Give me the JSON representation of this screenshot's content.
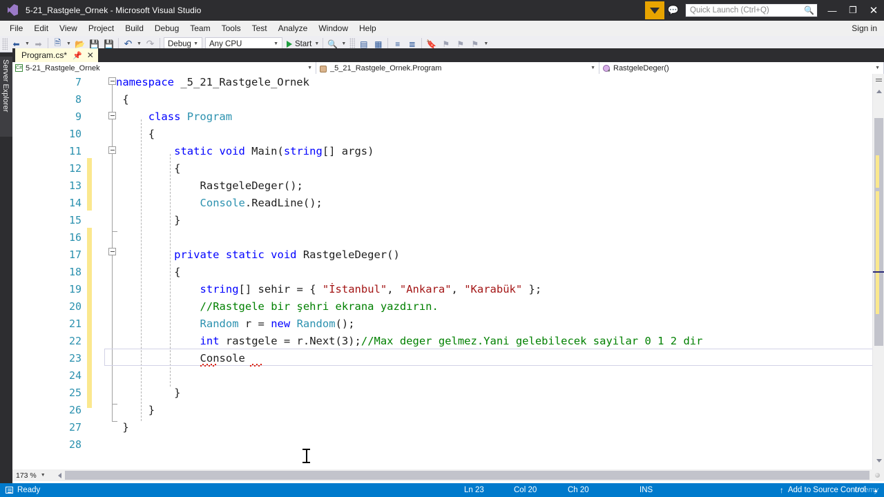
{
  "titlebar": {
    "logo": "vs-logo",
    "title": "5-21_Rastgele_Ornek - Microsoft Visual Studio",
    "filter_icon": "funnel-icon",
    "feedback_icon": "feedback-icon",
    "quick_launch_placeholder": "Quick Launch (Ctrl+Q)",
    "quick_launch_value": "",
    "search_icon": "magnifier-icon",
    "minimize": "—",
    "restore": "❐",
    "close": "✕"
  },
  "menubar": {
    "items": [
      {
        "label": "File"
      },
      {
        "label": "Edit"
      },
      {
        "label": "View"
      },
      {
        "label": "Project"
      },
      {
        "label": "Build"
      },
      {
        "label": "Debug"
      },
      {
        "label": "Team"
      },
      {
        "label": "Tools"
      },
      {
        "label": "Test"
      },
      {
        "label": "Analyze"
      },
      {
        "label": "Window"
      },
      {
        "label": "Help"
      }
    ],
    "signin": "Sign in"
  },
  "toolbar": {
    "navigate_back_icon": "navigate-back-icon",
    "navigate_forward_icon": "navigate-forward-icon",
    "new_project_icon": "new-project-icon",
    "open_file_icon": "open-file-icon",
    "save_icon": "save-icon",
    "save_all_icon": "save-all-icon",
    "undo_icon": "undo-icon",
    "redo_icon": "redo-icon",
    "config_value": "Debug",
    "platform_value": "Any CPU",
    "start_label": "Start",
    "find_icon": "find-icon",
    "comment_icon": "comment-icon",
    "uncomment_icon": "uncomment-icon",
    "indent_icon": "indent-icon",
    "outdent_icon": "outdent-icon",
    "bookmark_icon": "bookmark-icon",
    "bookmark_prev_icon": "bookmark-prev-icon",
    "bookmark_next_icon": "bookmark-next-icon",
    "bookmark_clear_icon": "bookmark-clear-icon",
    "overflow_icon": "toolbar-overflow-icon"
  },
  "leftdock": {
    "server_explorer": "Server Explorer"
  },
  "tabs": {
    "active": {
      "label": "Program.cs*",
      "pin_icon": "pin-icon",
      "close_icon": "close-icon"
    }
  },
  "navbar": {
    "project": "5-21_Rastgele_Ornek",
    "project_icon": "csharp-file-icon",
    "type": "_5_21_Rastgele_Ornek.Program",
    "type_icon": "class-icon",
    "member": "RastgeleDeger()",
    "member_icon": "method-icon",
    "dropdown_icon": "chevron-down-icon"
  },
  "editor": {
    "language": "csharp",
    "first_visible_line": 7,
    "caret_line": 23,
    "lines": [
      {
        "num": 7,
        "tokens": [
          {
            "t": "namespace",
            "c": "kw"
          },
          {
            "t": " _5_21_Rastgele_Ornek",
            "c": "pl"
          }
        ],
        "indent": 0
      },
      {
        "num": 8,
        "tokens": [
          {
            "t": "{",
            "c": "pl"
          }
        ],
        "indent": 1
      },
      {
        "num": 9,
        "tokens": [
          {
            "t": "class",
            "c": "kw"
          },
          {
            "t": " ",
            "c": "pl"
          },
          {
            "t": "Program",
            "c": "ty"
          }
        ],
        "indent": 5
      },
      {
        "num": 10,
        "tokens": [
          {
            "t": "{",
            "c": "pl"
          }
        ],
        "indent": 5
      },
      {
        "num": 11,
        "tokens": [
          {
            "t": "static",
            "c": "kw"
          },
          {
            "t": " ",
            "c": "pl"
          },
          {
            "t": "void",
            "c": "kw"
          },
          {
            "t": " Main(",
            "c": "pl"
          },
          {
            "t": "string",
            "c": "kw"
          },
          {
            "t": "[] args)",
            "c": "pl"
          }
        ],
        "indent": 9
      },
      {
        "num": 12,
        "tokens": [
          {
            "t": "{",
            "c": "pl"
          }
        ],
        "indent": 9
      },
      {
        "num": 13,
        "tokens": [
          {
            "t": "RastgeleDeger();",
            "c": "pl"
          }
        ],
        "indent": 13
      },
      {
        "num": 14,
        "tokens": [
          {
            "t": "Console",
            "c": "ty"
          },
          {
            "t": ".ReadLine();",
            "c": "pl"
          }
        ],
        "indent": 13
      },
      {
        "num": 15,
        "tokens": [
          {
            "t": "}",
            "c": "pl"
          }
        ],
        "indent": 9
      },
      {
        "num": 16,
        "tokens": [],
        "indent": 0
      },
      {
        "num": 17,
        "tokens": [
          {
            "t": "private",
            "c": "kw"
          },
          {
            "t": " ",
            "c": "pl"
          },
          {
            "t": "static",
            "c": "kw"
          },
          {
            "t": " ",
            "c": "pl"
          },
          {
            "t": "void",
            "c": "kw"
          },
          {
            "t": " RastgeleDeger()",
            "c": "pl"
          }
        ],
        "indent": 9
      },
      {
        "num": 18,
        "tokens": [
          {
            "t": "{",
            "c": "pl"
          }
        ],
        "indent": 9
      },
      {
        "num": 19,
        "tokens": [
          {
            "t": "string",
            "c": "kw"
          },
          {
            "t": "[] sehir = { ",
            "c": "pl"
          },
          {
            "t": "\"İstanbul\"",
            "c": "st"
          },
          {
            "t": ", ",
            "c": "pl"
          },
          {
            "t": "\"Ankara\"",
            "c": "st"
          },
          {
            "t": ", ",
            "c": "pl"
          },
          {
            "t": "\"Karabük\"",
            "c": "st"
          },
          {
            "t": " };",
            "c": "pl"
          }
        ],
        "indent": 13
      },
      {
        "num": 20,
        "tokens": [
          {
            "t": "//Rastgele bir şehri ekrana yazdırın.",
            "c": "cm"
          }
        ],
        "indent": 13
      },
      {
        "num": 21,
        "tokens": [
          {
            "t": "Random",
            "c": "ty"
          },
          {
            "t": " r = ",
            "c": "pl"
          },
          {
            "t": "new",
            "c": "kw"
          },
          {
            "t": " ",
            "c": "pl"
          },
          {
            "t": "Random",
            "c": "ty"
          },
          {
            "t": "();",
            "c": "pl"
          }
        ],
        "indent": 13
      },
      {
        "num": 22,
        "tokens": [
          {
            "t": "int",
            "c": "kw"
          },
          {
            "t": " rastgele = r.Next(3);",
            "c": "pl"
          },
          {
            "t": "//Max deger gelmez.Yani gelebilecek sayilar 0 1 2 dir",
            "c": "cm"
          }
        ],
        "indent": 13
      },
      {
        "num": 23,
        "tokens": [
          {
            "t": "Console",
            "c": "pl"
          }
        ],
        "indent": 13
      },
      {
        "num": 24,
        "tokens": [],
        "indent": 0
      },
      {
        "num": 25,
        "tokens": [
          {
            "t": "}",
            "c": "pl"
          }
        ],
        "indent": 9
      },
      {
        "num": 26,
        "tokens": [
          {
            "t": "}",
            "c": "pl"
          }
        ],
        "indent": 5
      },
      {
        "num": 27,
        "tokens": [
          {
            "t": "}",
            "c": "pl"
          }
        ],
        "indent": 1
      },
      {
        "num": 28,
        "tokens": [],
        "indent": 0
      }
    ]
  },
  "scrollbars": {
    "zoom_level": "173 %",
    "vertical_thumb": "vertical-scroll-thumb",
    "horizontal_thumb": "horizontal-scroll-thumb",
    "split_icon": "split-view-icon",
    "up_icon": "scroll-up-icon",
    "down_icon": "scroll-down-icon",
    "left_icon": "scroll-left-icon"
  },
  "statusbar": {
    "status_icon": "document-status-icon",
    "status": "Ready",
    "ln": "Ln 23",
    "col": "Col 20",
    "ch": "Ch 20",
    "ins": "INS",
    "source_control": "Add to Source Control",
    "source_control_icon": "upload-arrow-icon",
    "expand_icon": "chevron-up-icon",
    "watermark": "Udemy"
  },
  "colors": {
    "titlebar_bg": "#2d2d30",
    "accent_blue": "#007acc",
    "tab_active": "#fffcdd",
    "keyword": "#0000ff",
    "type": "#2b91af",
    "string": "#a31515",
    "comment": "#008000",
    "change_bar": "#fbe88e",
    "quick_launch_highlight": "#e8a400"
  }
}
